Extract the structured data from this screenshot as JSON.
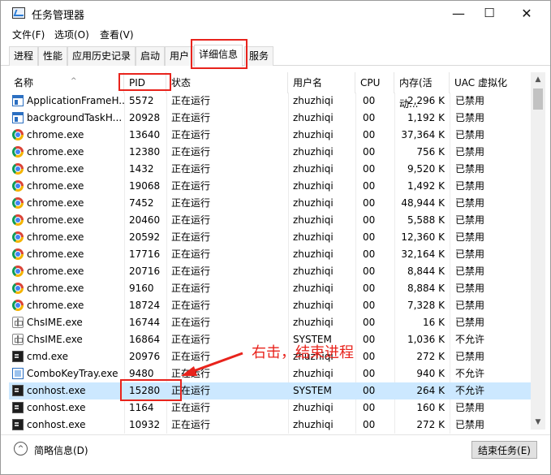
{
  "window": {
    "title": "任务管理器",
    "minimize": "—",
    "maximize": "☐",
    "close": "✕"
  },
  "menu": [
    "文件(F)",
    "选项(O)",
    "查看(V)"
  ],
  "tabs": [
    "进程",
    "性能",
    "应用历史记录",
    "启动",
    "用户",
    "详细信息",
    "服务"
  ],
  "active_tab": "详细信息",
  "columns": [
    "名称",
    "PID",
    "状态",
    "用户名",
    "CPU",
    "内存(活动...",
    "UAC 虚拟化"
  ],
  "rows": [
    {
      "icon": "window-icon",
      "name": "ApplicationFrameH...",
      "pid": "5572",
      "status": "正在运行",
      "user": "zhuzhiqi",
      "cpu": "00",
      "mem": "2,296 K",
      "uac": "已禁用"
    },
    {
      "icon": "window-icon",
      "name": "backgroundTaskH...",
      "pid": "20928",
      "status": "正在运行",
      "user": "zhuzhiqi",
      "cpu": "00",
      "mem": "1,192 K",
      "uac": "已禁用"
    },
    {
      "icon": "chrome-icon",
      "name": "chrome.exe",
      "pid": "13640",
      "status": "正在运行",
      "user": "zhuzhiqi",
      "cpu": "00",
      "mem": "37,364 K",
      "uac": "已禁用"
    },
    {
      "icon": "chrome-icon",
      "name": "chrome.exe",
      "pid": "12380",
      "status": "正在运行",
      "user": "zhuzhiqi",
      "cpu": "00",
      "mem": "756 K",
      "uac": "已禁用"
    },
    {
      "icon": "chrome-icon",
      "name": "chrome.exe",
      "pid": "1432",
      "status": "正在运行",
      "user": "zhuzhiqi",
      "cpu": "00",
      "mem": "9,520 K",
      "uac": "已禁用"
    },
    {
      "icon": "chrome-icon",
      "name": "chrome.exe",
      "pid": "19068",
      "status": "正在运行",
      "user": "zhuzhiqi",
      "cpu": "00",
      "mem": "1,492 K",
      "uac": "已禁用"
    },
    {
      "icon": "chrome-icon",
      "name": "chrome.exe",
      "pid": "7452",
      "status": "正在运行",
      "user": "zhuzhiqi",
      "cpu": "00",
      "mem": "48,944 K",
      "uac": "已禁用"
    },
    {
      "icon": "chrome-icon",
      "name": "chrome.exe",
      "pid": "20460",
      "status": "正在运行",
      "user": "zhuzhiqi",
      "cpu": "00",
      "mem": "5,588 K",
      "uac": "已禁用"
    },
    {
      "icon": "chrome-icon",
      "name": "chrome.exe",
      "pid": "20592",
      "status": "正在运行",
      "user": "zhuzhiqi",
      "cpu": "00",
      "mem": "12,360 K",
      "uac": "已禁用"
    },
    {
      "icon": "chrome-icon",
      "name": "chrome.exe",
      "pid": "17716",
      "status": "正在运行",
      "user": "zhuzhiqi",
      "cpu": "00",
      "mem": "32,164 K",
      "uac": "已禁用"
    },
    {
      "icon": "chrome-icon",
      "name": "chrome.exe",
      "pid": "20716",
      "status": "正在运行",
      "user": "zhuzhiqi",
      "cpu": "00",
      "mem": "8,844 K",
      "uac": "已禁用"
    },
    {
      "icon": "chrome-icon",
      "name": "chrome.exe",
      "pid": "9160",
      "status": "正在运行",
      "user": "zhuzhiqi",
      "cpu": "00",
      "mem": "8,884 K",
      "uac": "已禁用"
    },
    {
      "icon": "chrome-icon",
      "name": "chrome.exe",
      "pid": "18724",
      "status": "正在运行",
      "user": "zhuzhiqi",
      "cpu": "00",
      "mem": "7,328 K",
      "uac": "已禁用"
    },
    {
      "icon": "ime-icon",
      "name": "ChsIME.exe",
      "pid": "16744",
      "status": "正在运行",
      "user": "zhuzhiqi",
      "cpu": "00",
      "mem": "16 K",
      "uac": "已禁用"
    },
    {
      "icon": "ime-icon",
      "name": "ChsIME.exe",
      "pid": "16864",
      "status": "正在运行",
      "user": "SYSTEM",
      "cpu": "00",
      "mem": "1,036 K",
      "uac": "不允许"
    },
    {
      "icon": "cmd-icon",
      "name": "cmd.exe",
      "pid": "20976",
      "status": "正在运行",
      "user": "zhuzhiqi",
      "cpu": "00",
      "mem": "272 K",
      "uac": "已禁用"
    },
    {
      "icon": "combokey-icon",
      "name": "ComboKeyTray.exe",
      "pid": "9480",
      "status": "正在运行",
      "user": "zhuzhiqi",
      "cpu": "00",
      "mem": "940 K",
      "uac": "不允许"
    },
    {
      "icon": "cmd-icon",
      "name": "conhost.exe",
      "pid": "15280",
      "status": "正在运行",
      "user": "SYSTEM",
      "cpu": "00",
      "mem": "264 K",
      "uac": "不允许"
    },
    {
      "icon": "cmd-icon",
      "name": "conhost.exe",
      "pid": "1164",
      "status": "正在运行",
      "user": "zhuzhiqi",
      "cpu": "00",
      "mem": "160 K",
      "uac": "已禁用"
    },
    {
      "icon": "cmd-icon",
      "name": "conhost.exe",
      "pid": "10932",
      "status": "正在运行",
      "user": "zhuzhiqi",
      "cpu": "00",
      "mem": "272 K",
      "uac": "已禁用"
    }
  ],
  "selected_row": 17,
  "footer": {
    "fewer_details": "简略信息(D)",
    "end_task": "结束任务(E)"
  },
  "annotation": {
    "text": "右击，结束进程",
    "color": "#e8231c"
  }
}
